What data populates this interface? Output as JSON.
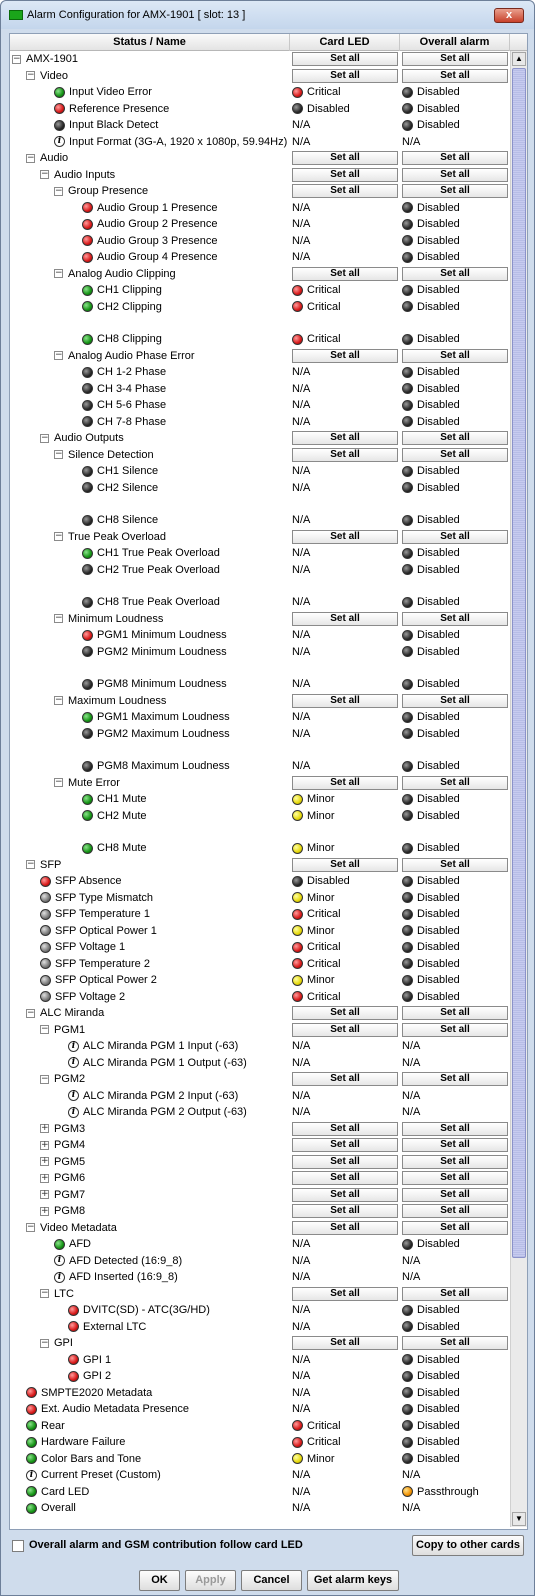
{
  "window": {
    "title": "Alarm Configuration for AMX-1901 [ slot: 13 ]",
    "close_label": "x"
  },
  "header": {
    "col1": "Status / Name",
    "col2": "Card LED",
    "col3": "Overall alarm"
  },
  "set_all_label": "Set all",
  "rows": [
    {
      "t": "AMX-1901",
      "toggle": "minus",
      "lvl": 0,
      "setall": true
    },
    {
      "t": "Video",
      "toggle": "minus",
      "lvl": 1,
      "setall": true
    },
    {
      "t": "Input Video Error",
      "led": "green",
      "lvl": 3,
      "c2": "Critical",
      "c2led": "red",
      "c3": "Disabled",
      "c3led": "black"
    },
    {
      "t": "Reference Presence",
      "led": "red",
      "lvl": 3,
      "c2": "Disabled",
      "c2led": "black",
      "c3": "Disabled",
      "c3led": "black"
    },
    {
      "t": "Input Black Detect",
      "led": "black",
      "lvl": 3,
      "c2": "N/A",
      "c3": "Disabled",
      "c3led": "black"
    },
    {
      "t": "Input Format (3G-A, 1920 x 1080p, 59.94Hz)",
      "led": "info",
      "lvl": 3,
      "c2": "N/A",
      "c3": "N/A"
    },
    {
      "t": "Audio",
      "toggle": "minus",
      "lvl": 1,
      "setall": true
    },
    {
      "t": "Audio Inputs",
      "toggle": "minus",
      "lvl": 2,
      "setall": true
    },
    {
      "t": "Group Presence",
      "toggle": "minus",
      "lvl": 3,
      "setall": true
    },
    {
      "t": "Audio Group 1 Presence",
      "led": "red",
      "lvl": 5,
      "c2": "N/A",
      "c3": "Disabled",
      "c3led": "black"
    },
    {
      "t": "Audio Group 2 Presence",
      "led": "red",
      "lvl": 5,
      "c2": "N/A",
      "c3": "Disabled",
      "c3led": "black"
    },
    {
      "t": "Audio Group 3 Presence",
      "led": "red",
      "lvl": 5,
      "c2": "N/A",
      "c3": "Disabled",
      "c3led": "black"
    },
    {
      "t": "Audio Group 4 Presence",
      "led": "red",
      "lvl": 5,
      "c2": "N/A",
      "c3": "Disabled",
      "c3led": "black"
    },
    {
      "t": "Analog Audio Clipping",
      "toggle": "minus",
      "lvl": 3,
      "setall": true
    },
    {
      "t": "CH1 Clipping",
      "led": "green",
      "lvl": 5,
      "c2": "Critical",
      "c2led": "red",
      "c3": "Disabled",
      "c3led": "black"
    },
    {
      "t": "CH2 Clipping",
      "led": "green",
      "lvl": 5,
      "c2": "Critical",
      "c2led": "red",
      "c3": "Disabled",
      "c3led": "black",
      "gap": true
    },
    {
      "t": "CH8 Clipping",
      "led": "green",
      "lvl": 5,
      "c2": "Critical",
      "c2led": "red",
      "c3": "Disabled",
      "c3led": "black"
    },
    {
      "t": "Analog Audio Phase Error",
      "toggle": "minus",
      "lvl": 3,
      "setall": true
    },
    {
      "t": "CH 1-2 Phase",
      "led": "black",
      "lvl": 5,
      "c2": "N/A",
      "c3": "Disabled",
      "c3led": "black"
    },
    {
      "t": "CH 3-4 Phase",
      "led": "black",
      "lvl": 5,
      "c2": "N/A",
      "c3": "Disabled",
      "c3led": "black"
    },
    {
      "t": "CH 5-6 Phase",
      "led": "black",
      "lvl": 5,
      "c2": "N/A",
      "c3": "Disabled",
      "c3led": "black"
    },
    {
      "t": "CH 7-8 Phase",
      "led": "black",
      "lvl": 5,
      "c2": "N/A",
      "c3": "Disabled",
      "c3led": "black"
    },
    {
      "t": "Audio Outputs",
      "toggle": "minus",
      "lvl": 2,
      "setall": true
    },
    {
      "t": "Silence Detection",
      "toggle": "minus",
      "lvl": 3,
      "setall": true
    },
    {
      "t": "CH1 Silence",
      "led": "black",
      "lvl": 5,
      "c2": "N/A",
      "c3": "Disabled",
      "c3led": "black"
    },
    {
      "t": "CH2 Silence",
      "led": "black",
      "lvl": 5,
      "c2": "N/A",
      "c3": "Disabled",
      "c3led": "black",
      "gap": true
    },
    {
      "t": "CH8 Silence",
      "led": "black",
      "lvl": 5,
      "c2": "N/A",
      "c3": "Disabled",
      "c3led": "black"
    },
    {
      "t": "True Peak Overload",
      "toggle": "minus",
      "lvl": 3,
      "setall": true
    },
    {
      "t": "CH1 True Peak Overload",
      "led": "green",
      "lvl": 5,
      "c2": "N/A",
      "c3": "Disabled",
      "c3led": "black"
    },
    {
      "t": "CH2 True Peak Overload",
      "led": "black",
      "lvl": 5,
      "c2": "N/A",
      "c3": "Disabled",
      "c3led": "black",
      "gap": true
    },
    {
      "t": "CH8 True Peak Overload",
      "led": "black",
      "lvl": 5,
      "c2": "N/A",
      "c3": "Disabled",
      "c3led": "black"
    },
    {
      "t": "Minimum Loudness",
      "toggle": "minus",
      "lvl": 3,
      "setall": true
    },
    {
      "t": "PGM1 Minimum Loudness",
      "led": "red",
      "lvl": 5,
      "c2": "N/A",
      "c3": "Disabled",
      "c3led": "black"
    },
    {
      "t": "PGM2 Minimum Loudness",
      "led": "black",
      "lvl": 5,
      "c2": "N/A",
      "c3": "Disabled",
      "c3led": "black",
      "gap": true
    },
    {
      "t": "PGM8 Minimum Loudness",
      "led": "black",
      "lvl": 5,
      "c2": "N/A",
      "c3": "Disabled",
      "c3led": "black"
    },
    {
      "t": "Maximum Loudness",
      "toggle": "minus",
      "lvl": 3,
      "setall": true
    },
    {
      "t": "PGM1 Maximum Loudness",
      "led": "green",
      "lvl": 5,
      "c2": "N/A",
      "c3": "Disabled",
      "c3led": "black"
    },
    {
      "t": "PGM2 Maximum Loudness",
      "led": "black",
      "lvl": 5,
      "c2": "N/A",
      "c3": "Disabled",
      "c3led": "black",
      "gap": true
    },
    {
      "t": "PGM8 Maximum Loudness",
      "led": "black",
      "lvl": 5,
      "c2": "N/A",
      "c3": "Disabled",
      "c3led": "black"
    },
    {
      "t": "Mute Error",
      "toggle": "minus",
      "lvl": 3,
      "setall": true
    },
    {
      "t": "CH1 Mute",
      "led": "green",
      "lvl": 5,
      "c2": "Minor",
      "c2led": "yellow",
      "c3": "Disabled",
      "c3led": "black"
    },
    {
      "t": "CH2 Mute",
      "led": "green",
      "lvl": 5,
      "c2": "Minor",
      "c2led": "yellow",
      "c3": "Disabled",
      "c3led": "black",
      "gap": true
    },
    {
      "t": "CH8 Mute",
      "led": "green",
      "lvl": 5,
      "c2": "Minor",
      "c2led": "yellow",
      "c3": "Disabled",
      "c3led": "black"
    },
    {
      "t": "SFP",
      "toggle": "minus",
      "lvl": 1,
      "setall": true
    },
    {
      "t": "SFP Absence",
      "led": "red",
      "lvl": 2,
      "c2": "Disabled",
      "c2led": "black",
      "c3": "Disabled",
      "c3led": "black"
    },
    {
      "t": "SFP Type Mismatch",
      "led": "gray",
      "lvl": 2,
      "c2": "Minor",
      "c2led": "yellow",
      "c3": "Disabled",
      "c3led": "black"
    },
    {
      "t": "SFP Temperature 1",
      "led": "gray",
      "lvl": 2,
      "c2": "Critical",
      "c2led": "red",
      "c3": "Disabled",
      "c3led": "black"
    },
    {
      "t": "SFP Optical Power 1",
      "led": "gray",
      "lvl": 2,
      "c2": "Minor",
      "c2led": "yellow",
      "c3": "Disabled",
      "c3led": "black"
    },
    {
      "t": "SFP Voltage 1",
      "led": "gray",
      "lvl": 2,
      "c2": "Critical",
      "c2led": "red",
      "c3": "Disabled",
      "c3led": "black"
    },
    {
      "t": "SFP Temperature 2",
      "led": "gray",
      "lvl": 2,
      "c2": "Critical",
      "c2led": "red",
      "c3": "Disabled",
      "c3led": "black"
    },
    {
      "t": "SFP Optical Power 2",
      "led": "gray",
      "lvl": 2,
      "c2": "Minor",
      "c2led": "yellow",
      "c3": "Disabled",
      "c3led": "black"
    },
    {
      "t": "SFP Voltage 2",
      "led": "gray",
      "lvl": 2,
      "c2": "Critical",
      "c2led": "red",
      "c3": "Disabled",
      "c3led": "black"
    },
    {
      "t": "ALC Miranda",
      "toggle": "minus",
      "lvl": 1,
      "setall": true
    },
    {
      "t": "PGM1",
      "toggle": "minus",
      "lvl": 2,
      "setall": true
    },
    {
      "t": "ALC Miranda PGM 1 Input (-63)",
      "led": "info",
      "lvl": 4,
      "c2": "N/A",
      "c3": "N/A"
    },
    {
      "t": "ALC Miranda PGM 1 Output (-63)",
      "led": "info",
      "lvl": 4,
      "c2": "N/A",
      "c3": "N/A"
    },
    {
      "t": "PGM2",
      "toggle": "minus",
      "lvl": 2,
      "setall": true
    },
    {
      "t": "ALC Miranda PGM 2 Input (-63)",
      "led": "info",
      "lvl": 4,
      "c2": "N/A",
      "c3": "N/A"
    },
    {
      "t": "ALC Miranda PGM 2 Output (-63)",
      "led": "info",
      "lvl": 4,
      "c2": "N/A",
      "c3": "N/A"
    },
    {
      "t": "PGM3",
      "toggle": "plus",
      "lvl": 2,
      "setall": true
    },
    {
      "t": "PGM4",
      "toggle": "plus",
      "lvl": 2,
      "setall": true
    },
    {
      "t": "PGM5",
      "toggle": "plus",
      "lvl": 2,
      "setall": true
    },
    {
      "t": "PGM6",
      "toggle": "plus",
      "lvl": 2,
      "setall": true
    },
    {
      "t": "PGM7",
      "toggle": "plus",
      "lvl": 2,
      "setall": true
    },
    {
      "t": "PGM8",
      "toggle": "plus",
      "lvl": 2,
      "setall": true
    },
    {
      "t": "Video Metadata",
      "toggle": "minus",
      "lvl": 1,
      "setall": true
    },
    {
      "t": "AFD",
      "led": "green",
      "lvl": 3,
      "c2": "N/A",
      "c3": "Disabled",
      "c3led": "black"
    },
    {
      "t": "AFD Detected (16:9_8)",
      "led": "info",
      "lvl": 3,
      "c2": "N/A",
      "c3": "N/A"
    },
    {
      "t": "AFD Inserted (16:9_8)",
      "led": "info",
      "lvl": 3,
      "c2": "N/A",
      "c3": "N/A"
    },
    {
      "t": "LTC",
      "toggle": "minus",
      "lvl": 2,
      "setall": true
    },
    {
      "t": "DVITC(SD) - ATC(3G/HD)",
      "led": "red",
      "lvl": 4,
      "c2": "N/A",
      "c3": "Disabled",
      "c3led": "black"
    },
    {
      "t": "External LTC",
      "led": "red",
      "lvl": 4,
      "c2": "N/A",
      "c3": "Disabled",
      "c3led": "black"
    },
    {
      "t": "GPI",
      "toggle": "minus",
      "lvl": 2,
      "setall": true
    },
    {
      "t": "GPI 1",
      "led": "red",
      "lvl": 4,
      "c2": "N/A",
      "c3": "Disabled",
      "c3led": "black"
    },
    {
      "t": "GPI 2",
      "led": "red",
      "lvl": 4,
      "c2": "N/A",
      "c3": "Disabled",
      "c3led": "black"
    },
    {
      "t": "SMPTE2020 Metadata",
      "led": "red",
      "lvl": 1,
      "c2": "N/A",
      "c3": "Disabled",
      "c3led": "black"
    },
    {
      "t": "Ext. Audio Metadata Presence",
      "led": "red",
      "lvl": 1,
      "c2": "N/A",
      "c3": "Disabled",
      "c3led": "black"
    },
    {
      "t": "Rear",
      "led": "green",
      "lvl": 1,
      "c2": "Critical",
      "c2led": "red",
      "c3": "Disabled",
      "c3led": "black"
    },
    {
      "t": "Hardware Failure",
      "led": "green",
      "lvl": 1,
      "c2": "Critical",
      "c2led": "red",
      "c3": "Disabled",
      "c3led": "black"
    },
    {
      "t": "Color Bars and Tone",
      "led": "green",
      "lvl": 1,
      "c2": "Minor",
      "c2led": "yellow",
      "c3": "Disabled",
      "c3led": "black"
    },
    {
      "t": "Current Preset (Custom)",
      "led": "info",
      "lvl": 1,
      "c2": "N/A",
      "c3": "N/A"
    },
    {
      "t": "Card LED",
      "led": "green",
      "lvl": 1,
      "c2": "N/A",
      "c3": "Passthrough",
      "c3led": "orange"
    },
    {
      "t": "Overall",
      "led": "green",
      "lvl": 1,
      "c2": "N/A",
      "c3": "N/A"
    }
  ],
  "footer": {
    "follow_label": "Overall alarm and GSM contribution follow card LED",
    "copy_label": "Copy to other cards"
  },
  "buttons": {
    "ok": "OK",
    "apply": "Apply",
    "cancel": "Cancel",
    "keys": "Get alarm keys"
  }
}
